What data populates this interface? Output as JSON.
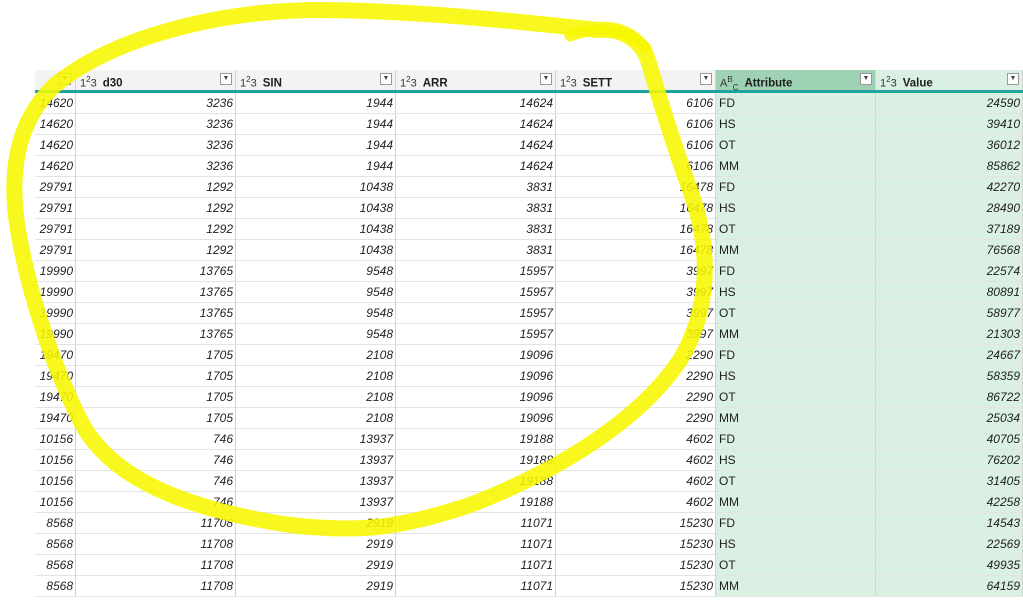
{
  "columns": [
    {
      "type_icon": "",
      "name": ""
    },
    {
      "type_icon": "1²3",
      "name": "d30"
    },
    {
      "type_icon": "1²3",
      "name": "SIN"
    },
    {
      "type_icon": "1²3",
      "name": "ARR"
    },
    {
      "type_icon": "1²3",
      "name": "SETT"
    },
    {
      "type_icon": "A^B_C",
      "name": "Attribute"
    },
    {
      "type_icon": "1²3",
      "name": "Value"
    }
  ],
  "rows": [
    [
      "14620",
      "3236",
      "1944",
      "14624",
      "6106",
      "FD",
      "24590"
    ],
    [
      "14620",
      "3236",
      "1944",
      "14624",
      "6106",
      "HS",
      "39410"
    ],
    [
      "14620",
      "3236",
      "1944",
      "14624",
      "6106",
      "OT",
      "36012"
    ],
    [
      "14620",
      "3236",
      "1944",
      "14624",
      "6106",
      "MM",
      "85862"
    ],
    [
      "29791",
      "1292",
      "10438",
      "3831",
      "16478",
      "FD",
      "42270"
    ],
    [
      "29791",
      "1292",
      "10438",
      "3831",
      "16478",
      "HS",
      "28490"
    ],
    [
      "29791",
      "1292",
      "10438",
      "3831",
      "16478",
      "OT",
      "37189"
    ],
    [
      "29791",
      "1292",
      "10438",
      "3831",
      "16478",
      "MM",
      "76568"
    ],
    [
      "19990",
      "13765",
      "9548",
      "15957",
      "3997",
      "FD",
      "22574"
    ],
    [
      "19990",
      "13765",
      "9548",
      "15957",
      "3997",
      "HS",
      "80891"
    ],
    [
      "19990",
      "13765",
      "9548",
      "15957",
      "3997",
      "OT",
      "58977"
    ],
    [
      "19990",
      "13765",
      "9548",
      "15957",
      "3997",
      "MM",
      "21303"
    ],
    [
      "19470",
      "1705",
      "2108",
      "19096",
      "2290",
      "FD",
      "24667"
    ],
    [
      "19470",
      "1705",
      "2108",
      "19096",
      "2290",
      "HS",
      "58359"
    ],
    [
      "19470",
      "1705",
      "2108",
      "19096",
      "2290",
      "OT",
      "86722"
    ],
    [
      "19470",
      "1705",
      "2108",
      "19096",
      "2290",
      "MM",
      "25034"
    ],
    [
      "10156",
      "746",
      "13937",
      "19188",
      "4602",
      "FD",
      "40705"
    ],
    [
      "10156",
      "746",
      "13937",
      "19188",
      "4602",
      "HS",
      "76202"
    ],
    [
      "10156",
      "746",
      "13937",
      "19188",
      "4602",
      "OT",
      "31405"
    ],
    [
      "10156",
      "746",
      "13937",
      "19188",
      "4602",
      "MM",
      "42258"
    ],
    [
      "8568",
      "11708",
      "2919",
      "11071",
      "15230",
      "FD",
      "14543"
    ],
    [
      "8568",
      "11708",
      "2919",
      "11071",
      "15230",
      "HS",
      "22569"
    ],
    [
      "8568",
      "11708",
      "2919",
      "11071",
      "15230",
      "OT",
      "49935"
    ],
    [
      "8568",
      "11708",
      "2919",
      "11071",
      "15230",
      "MM",
      "64159"
    ]
  ],
  "annotation": {
    "color": "#ffff00",
    "description_icon": "yellow-freehand-circle"
  },
  "colors": {
    "selected_header": "#9fd2b4",
    "selected_column": "#d9f0e3",
    "header_rule": "#1fa39a"
  }
}
